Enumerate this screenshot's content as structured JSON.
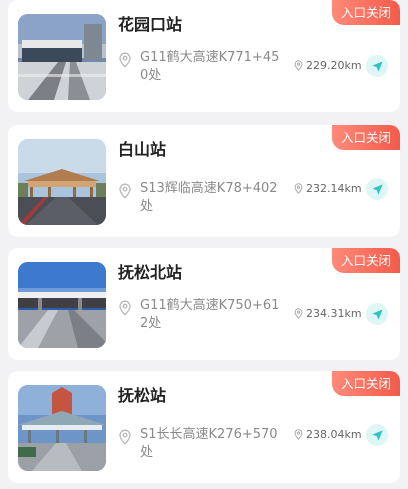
{
  "colors": {
    "badge": "#f25b4a",
    "title": "#222222",
    "address": "#8a8a8a",
    "navigate": "#2ec4c4"
  },
  "stations": [
    {
      "name": "花园口站",
      "status": "入口关闭",
      "address": "G11鹤大高速K771+450处",
      "distance": "229.20km",
      "thumbnail_icon": "toll-station-photo",
      "nav_icon": "navigate-arrow-icon"
    },
    {
      "name": "白山站",
      "status": "入口关闭",
      "address": "S13辉临高速K78+402处",
      "distance": "232.14km",
      "thumbnail_icon": "toll-station-photo",
      "nav_icon": "navigate-arrow-icon"
    },
    {
      "name": "抚松北站",
      "status": "入口关闭",
      "address": "G11鹤大高速K750+612处",
      "distance": "234.31km",
      "thumbnail_icon": "toll-station-photo",
      "nav_icon": "navigate-arrow-icon"
    },
    {
      "name": "抚松站",
      "status": "入口关闭",
      "address": "S1长长高速K276+570处",
      "distance": "238.04km",
      "thumbnail_icon": "toll-station-photo",
      "nav_icon": "navigate-arrow-icon"
    }
  ]
}
